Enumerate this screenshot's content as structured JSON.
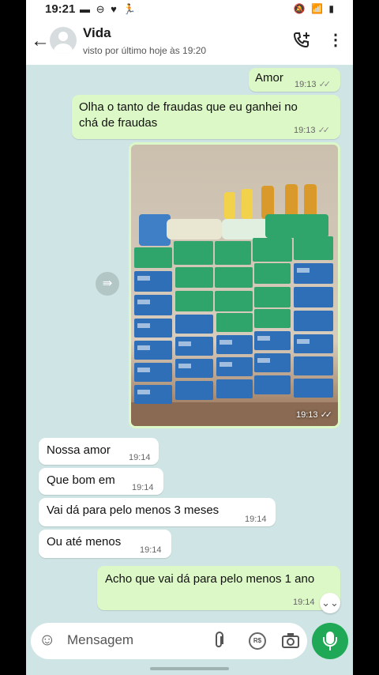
{
  "status_bar": {
    "time": "19:21",
    "left_icons": "▬ ⊖ ♥ 🏃",
    "right_icons": "🔕 📶 ▮"
  },
  "header": {
    "contact_name": "Vida",
    "last_seen": "visto por último hoje às 19:20",
    "back_icon": "back-arrow-icon",
    "call_icon": "add-call-icon",
    "menu_icon": "more-vertical-icon"
  },
  "messages": [
    {
      "direction": "out",
      "text": "Amor",
      "time": "19:13",
      "ticks": "✓✓"
    },
    {
      "direction": "out",
      "text_line1": "Olha o tanto de fraudas que eu ganhei no",
      "text_line2": "chá de fraudas",
      "time": "19:13",
      "ticks": "✓✓"
    },
    {
      "direction": "out",
      "type": "image",
      "time": "19:13",
      "ticks": "✓✓"
    },
    {
      "direction": "in",
      "text": "Nossa amor",
      "time": "19:14"
    },
    {
      "direction": "in",
      "text": "Que bom em",
      "time": "19:14"
    },
    {
      "direction": "in",
      "text": "Vai dá para pelo menos 3 meses",
      "time": "19:14"
    },
    {
      "direction": "in",
      "text": "Ou até menos",
      "time": "19:14"
    },
    {
      "direction": "out",
      "text": "Acho que vai dá para pelo menos 1 ano",
      "time": "19:14"
    }
  ],
  "composer": {
    "placeholder": "Mensagem",
    "pay_label": "R$"
  },
  "colors": {
    "outgoing_bubble": "#dcf8c6",
    "incoming_bubble": "#ffffff",
    "background": "#cfe4e4",
    "mic_button": "#1fa855"
  }
}
